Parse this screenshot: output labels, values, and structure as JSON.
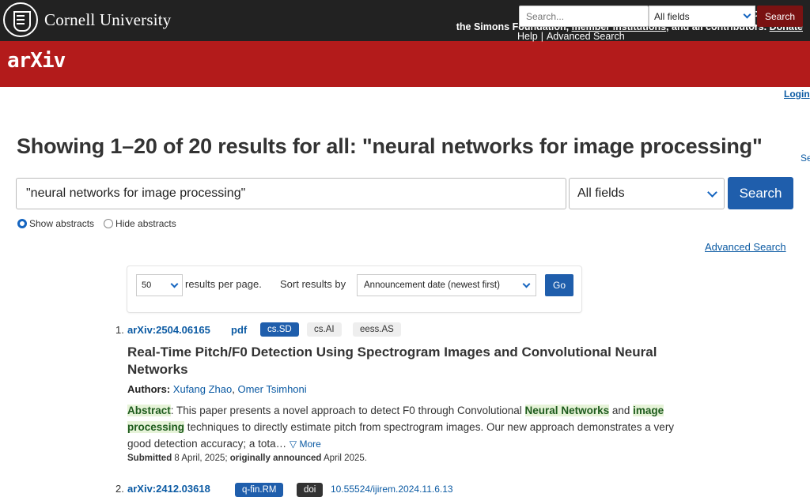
{
  "topbar": {
    "brand": "Cornell University",
    "ack_line1": "We gratefully acknowledge support from",
    "ack_line2_pre": "the Simons Foundation,",
    "member_link": "member institutions",
    "ack_line2_mid": ", and all contributors.",
    "donate_link": "Donate"
  },
  "header": {
    "logo": "arXiv",
    "search_placeholder": "Search...",
    "field_select": "All fields",
    "search_button": "Search",
    "help_link": "Help",
    "separator": "|",
    "advanced_link": "Advanced Search"
  },
  "login": "Login",
  "page": {
    "title": "Showing 1–20 of 20 results for all: \"neural networks for image processing\"",
    "truncated_link": "Se"
  },
  "search_form": {
    "query": "\"neural networks for image processing\"",
    "field": "All fields",
    "button": "Search",
    "show_abstracts": "Show abstracts",
    "hide_abstracts": "Hide abstracts",
    "advanced": "Advanced Search"
  },
  "controls": {
    "per_page": "50",
    "per_page_text": "results per page.",
    "sort_text": "Sort results by",
    "sort_value": "Announcement date (newest first)",
    "go": "Go"
  },
  "results": [
    {
      "num": "1.",
      "id": "arXiv:2504.06165",
      "pdf": "pdf",
      "tags": [
        "cs.SD",
        "cs.AI",
        "eess.AS"
      ],
      "title": "Real-Time Pitch/F0 Detection Using Spectrogram Images and Convolutional Neural Networks",
      "authors_label": "Authors:",
      "authors": [
        "Xufang Zhao",
        "Omer Tsimhoni"
      ],
      "abstract_label": "Abstract",
      "abstract_a": ": This paper presents a novel approach to detect F0 through Convolutional ",
      "abstract_hl1": "Neural Networks",
      "abstract_b": " and ",
      "abstract_hl2": "image processing",
      "abstract_c": " techniques to directly estimate pitch from spectrogram images. Our new approach demonstrates a very good detection accuracy; a tota…",
      "more": "▽ More",
      "submitted_label": "Submitted",
      "submitted": " 8 April, 2025; ",
      "announced_label": "originally announced",
      "announced": " April 2025."
    },
    {
      "num": "2.",
      "id": "arXiv:2412.03618",
      "tags": [
        "q-fin.RM",
        "doi"
      ],
      "doi": "10.55524/ijirem.2024.11.6.13"
    }
  ],
  "colors": {
    "arxiv_red": "#b31b1b",
    "link_blue": "#0b5aa3",
    "button_blue": "#1f5eac"
  }
}
